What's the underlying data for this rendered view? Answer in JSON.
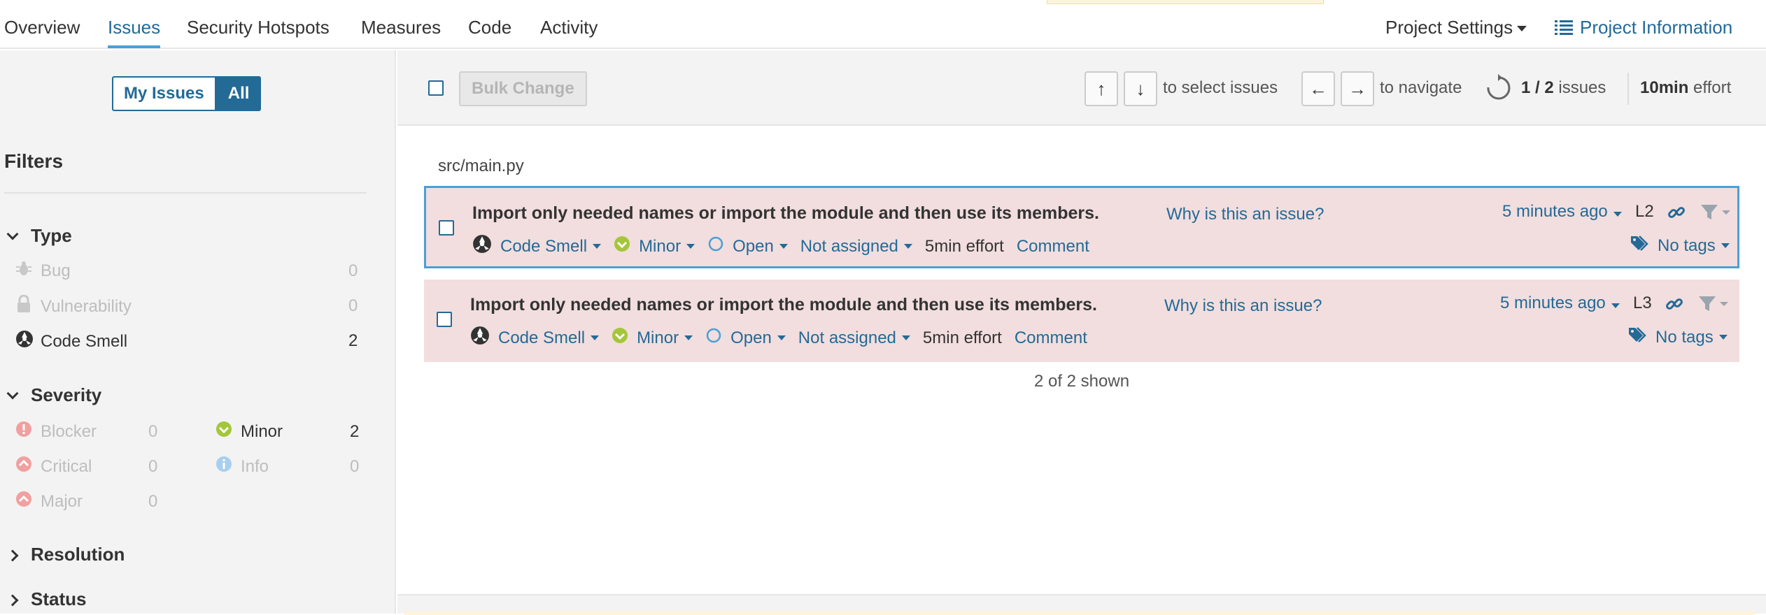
{
  "nav": {
    "tabs": [
      {
        "label": "Overview"
      },
      {
        "label": "Issues"
      },
      {
        "label": "Security Hotspots"
      },
      {
        "label": "Measures"
      },
      {
        "label": "Code"
      },
      {
        "label": "Activity"
      }
    ],
    "active_tab": "Issues",
    "project_settings": "Project Settings",
    "project_information": "Project Information"
  },
  "sidebar": {
    "toggle": {
      "my_issues": "My Issues",
      "all": "All",
      "selected": "All"
    },
    "filters_title": "Filters",
    "type": {
      "title": "Type",
      "expanded": true,
      "items": [
        {
          "label": "Bug",
          "count": "0",
          "icon": "bug-icon"
        },
        {
          "label": "Vulnerability",
          "count": "0",
          "icon": "lock-icon"
        },
        {
          "label": "Code Smell",
          "count": "2",
          "icon": "code-smell-icon"
        }
      ]
    },
    "severity": {
      "title": "Severity",
      "expanded": true,
      "items": [
        {
          "label": "Blocker",
          "count": "0",
          "icon": "blocker-icon"
        },
        {
          "label": "Minor",
          "count": "2",
          "icon": "minor-icon"
        },
        {
          "label": "Critical",
          "count": "0",
          "icon": "critical-icon"
        },
        {
          "label": "Info",
          "count": "0",
          "icon": "info-icon"
        },
        {
          "label": "Major",
          "count": "0",
          "icon": "major-icon"
        }
      ]
    },
    "resolution": {
      "title": "Resolution",
      "expanded": false
    },
    "status": {
      "title": "Status",
      "expanded": false
    }
  },
  "toolbar": {
    "bulk_change": "Bulk Change",
    "up_key": "↑",
    "down_key": "↓",
    "select_text": "to select issues",
    "left_key": "←",
    "right_key": "→",
    "navigate_text": "to navigate",
    "issues_count": "1 / 2",
    "issues_label": "issues",
    "effort_value": "10min",
    "effort_label": "effort"
  },
  "main": {
    "file_path": "src/main.py",
    "issues": [
      {
        "message": "Import only needed names or import the module and then use its members.",
        "why": "Why is this an issue?",
        "type": "Code Smell",
        "severity": "Minor",
        "status": "Open",
        "assignee": "Not assigned",
        "effort": "5min effort",
        "comment": "Comment",
        "when": "5 minutes ago",
        "line": "L2",
        "tags": "No tags",
        "selected": true
      },
      {
        "message": "Import only needed names or import the module and then use its members.",
        "why": "Why is this an issue?",
        "type": "Code Smell",
        "severity": "Minor",
        "status": "Open",
        "assignee": "Not assigned",
        "effort": "5min effort",
        "comment": "Comment",
        "when": "5 minutes ago",
        "line": "L3",
        "tags": "No tags",
        "selected": false
      }
    ],
    "shown_text": "2 of 2 shown"
  },
  "colors": {
    "link": "#236a97",
    "accent": "#4b9fd5",
    "issue_bg": "#f2dede",
    "minor": "#a4c639",
    "disabled": "#bdbdbd",
    "sidebar_bg": "#f3f3f3"
  }
}
